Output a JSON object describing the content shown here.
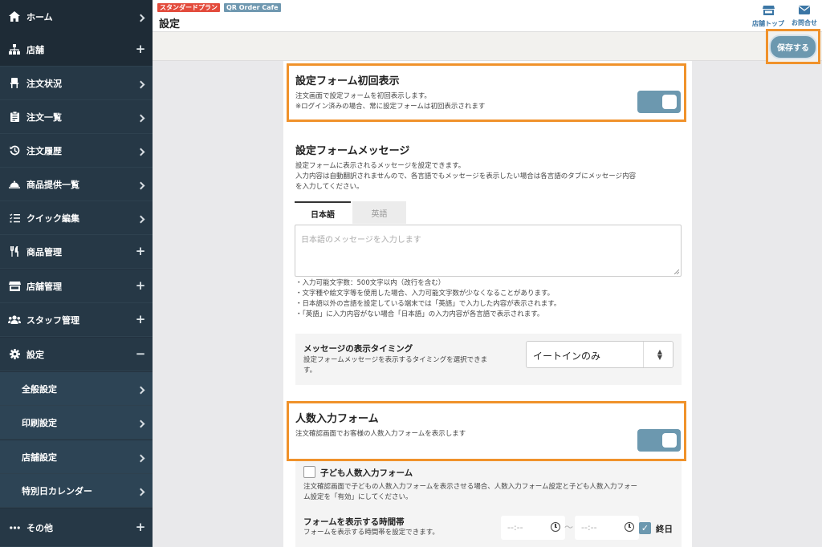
{
  "sidebar": {
    "items": [
      {
        "label": "ホーム",
        "icon": "home-icon",
        "trail": "chevron"
      },
      {
        "label": "店舗",
        "icon": "sitemap-icon",
        "trail": "plus"
      },
      {
        "label": "注文状況",
        "icon": "chair-icon",
        "trail": "chevron"
      },
      {
        "label": "注文一覧",
        "icon": "clipboard-icon",
        "trail": "chevron"
      },
      {
        "label": "注文履歴",
        "icon": "history-icon",
        "trail": "chevron"
      },
      {
        "label": "商品提供一覧",
        "icon": "cloche-icon",
        "trail": "chevron"
      },
      {
        "label": "クイック編集",
        "icon": "checklist-icon",
        "trail": "chevron"
      },
      {
        "label": "商品管理",
        "icon": "utensils-icon",
        "trail": "plus"
      },
      {
        "label": "店舗管理",
        "icon": "store-icon",
        "trail": "plus"
      },
      {
        "label": "スタッフ管理",
        "icon": "users-icon",
        "trail": "plus"
      },
      {
        "label": "設定",
        "icon": "gear-icon",
        "trail": "minus"
      }
    ],
    "subitems": [
      {
        "label": "全般設定"
      },
      {
        "label": "印刷設定"
      },
      {
        "label": "店舗設定"
      },
      {
        "label": "特別日カレンダー"
      }
    ],
    "other": {
      "label": "その他",
      "icon": "ellipsis-icon"
    },
    "plus_symbol": "+",
    "minus_symbol": "−"
  },
  "header": {
    "plan_badge": "スタンダードプラン",
    "shop_badge": "QR Order Cafe",
    "title": "設定",
    "store_top_label": "店舗トップ",
    "contact_label": "お問合せ"
  },
  "toolbar": {
    "save_label": "保存する"
  },
  "initial_display": {
    "title": "設定フォーム初回表示",
    "desc1": "注文画面で設定フォームを初回表示します。",
    "desc2": "※ログイン済みの場合、常に設定フォームは初回表示されます",
    "enabled": true
  },
  "form_message": {
    "title": "設定フォームメッセージ",
    "desc1": "設定フォームに表示されるメッセージを設定できます。",
    "desc2": "入力内容は自動翻訳されませんので、各言語でもメッセージを表示したい場合は各言語のタブにメッセージ内容",
    "desc3": "を入力してください。",
    "tabs": [
      {
        "label": "日本語"
      },
      {
        "label": "英語"
      }
    ],
    "placeholder": "日本語のメッセージを入力します",
    "notes": [
      "・入力可能文字数：500文字以内（改行を含む）",
      "・文字種や絵文字等を使用した場合、入力可能文字数が少なくなることがあります。",
      "・日本語以外の言語を設定している端末では「英語」で入力した内容が表示されます。",
      "・「英語」に入力内容がない場合「日本語」の入力内容が各言語で表示されます。"
    ]
  },
  "timing": {
    "title": "メッセージの表示タイミング",
    "desc1": "設定フォームメッセージを表示するタイミングを選択できま",
    "desc2": "す。",
    "selected": "イートインのみ"
  },
  "people_form": {
    "title": "人数入力フォーム",
    "desc": "注文確認画面でお客様の人数入力フォームを表示します",
    "enabled": true
  },
  "child_form": {
    "label": "子ども人数入力フォーム",
    "desc1": "注文確認画面で子どもの人数入力フォームを表示させる場合、人数入力フォーム設定と子ども人数入力フォー",
    "desc2": "ム設定を「有効」にしてください。",
    "checked": false
  },
  "time_range": {
    "title": "フォームを表示する時間帯",
    "desc": "フォームを表示する時間帯を設定できます。",
    "start_placeholder": "--:--",
    "end_placeholder": "--:--",
    "separator": "〜",
    "allday_label": "終日",
    "allday_checked": true
  },
  "colors": {
    "accent": "#6c98af",
    "highlight": "#f0922b",
    "sidebar": "#23323f",
    "danger": "#e34b3c"
  }
}
